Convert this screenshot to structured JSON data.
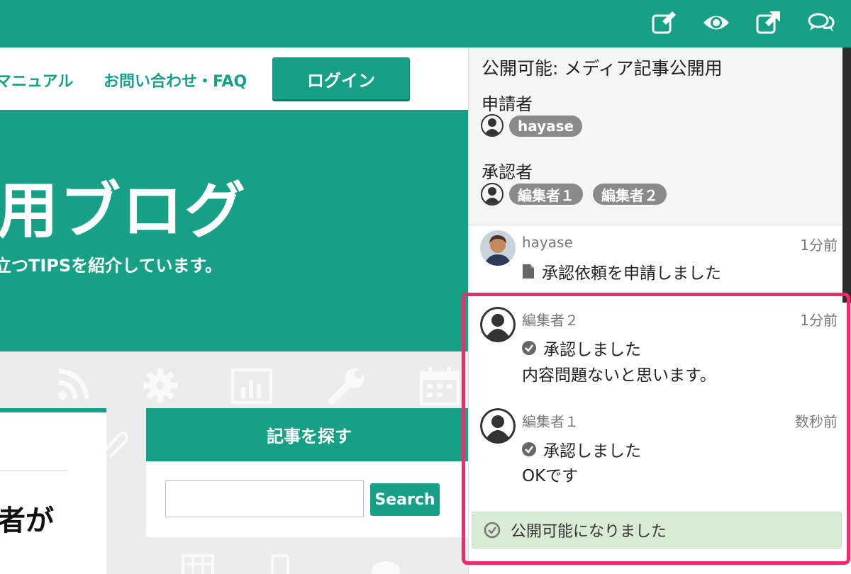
{
  "topbar": {
    "icons": [
      "edit-icon",
      "eye-icon",
      "external-link-icon",
      "comments-icon"
    ]
  },
  "site": {
    "nav": {
      "manual": "マニュアル",
      "contact": "お問い合わせ・FAQ",
      "login": "ログイン"
    },
    "hero": {
      "title": "用ブログ",
      "subtitle": "立つTIPSを紹介しています。"
    },
    "card": {
      "heading_fragment": "者が"
    },
    "widget": {
      "title": "記事を探す",
      "search_value": "",
      "search_button": "Search"
    }
  },
  "panel": {
    "title": "公開可能: メディア記事公開用",
    "applicant_label": "申請者",
    "applicant": "hayase",
    "approver_label": "承認者",
    "approvers": [
      "編集者１",
      "編集者２"
    ],
    "activities": [
      {
        "name": "hayase",
        "time": "1分前",
        "action": "承認依頼を申請しました",
        "comment": ""
      },
      {
        "name": "編集者２",
        "time": "1分前",
        "action": "承認しました",
        "comment": "内容問題ないと思います。"
      },
      {
        "name": "編集者１",
        "time": "数秒前",
        "action": "承認しました",
        "comment": "OKです"
      }
    ],
    "status": "公開可能になりました"
  },
  "colors": {
    "brand": "#16a085",
    "highlight": "#ee2a6a",
    "status_bg": "#d8ecd3",
    "tag": "#8a8a8a"
  }
}
